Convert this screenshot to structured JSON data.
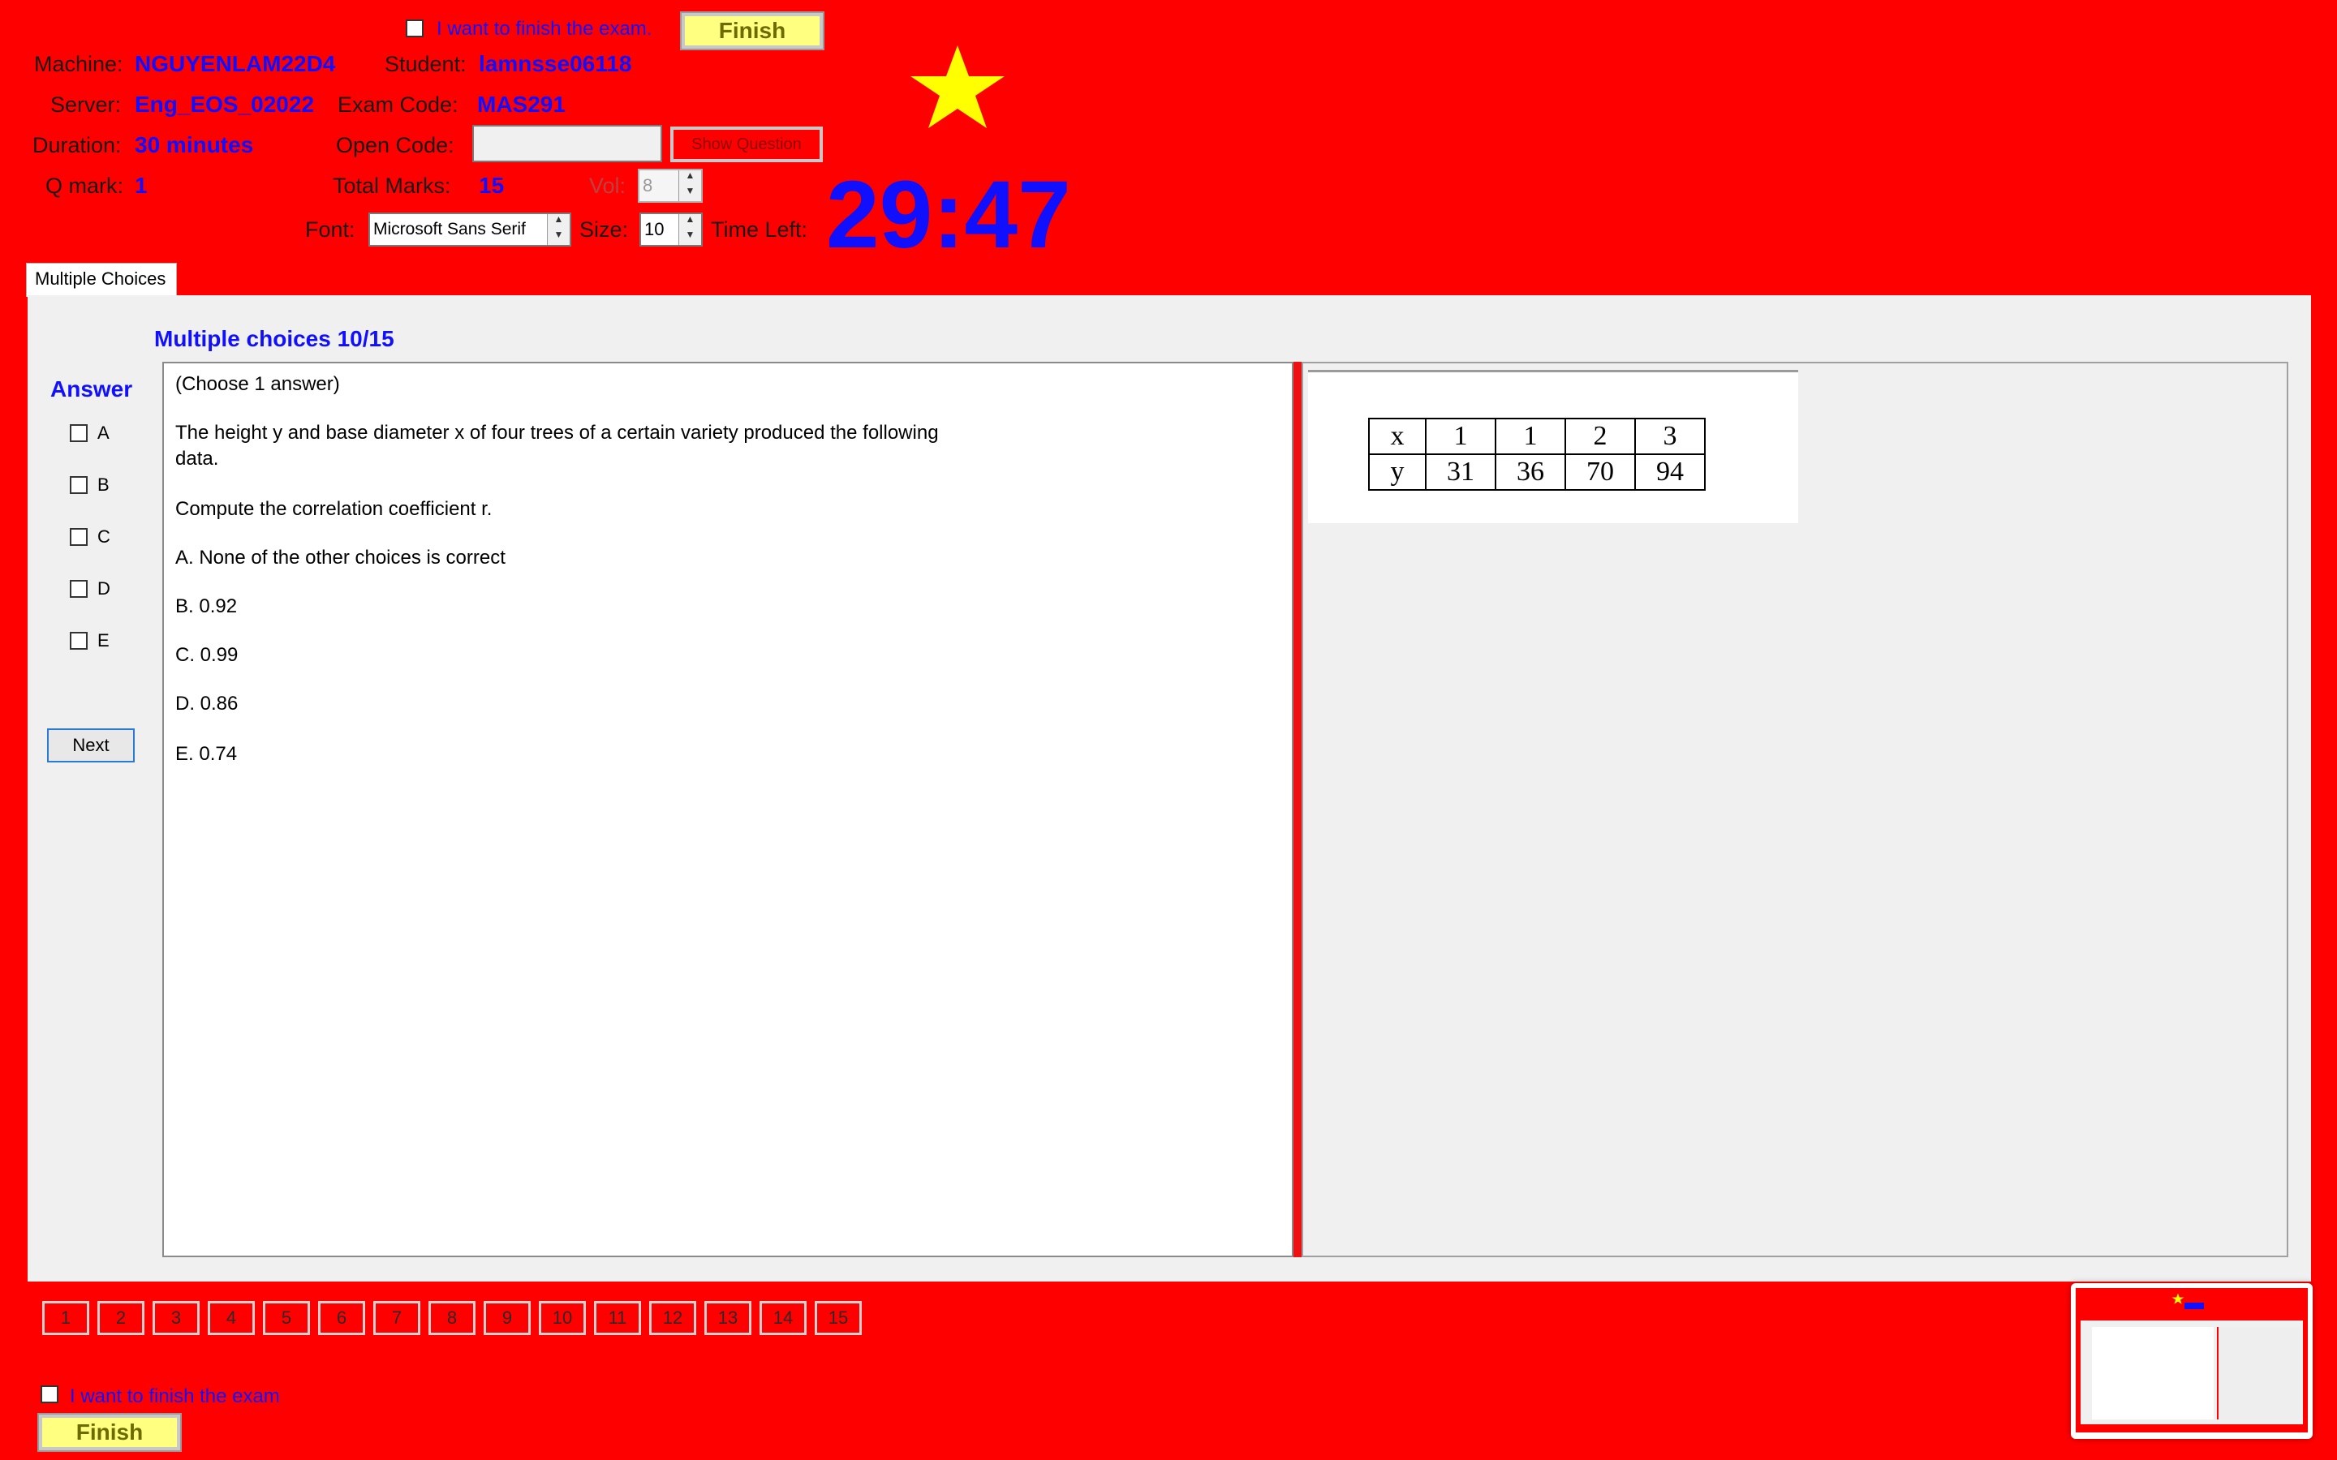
{
  "header": {
    "finish_top_label": "I want to finish the exam.",
    "finish_button": "Finish",
    "machine_label": "Machine:",
    "machine_value": "NGUYENLAM22D4",
    "student_label": "Student:",
    "student_value": "lamnsse06118",
    "server_label": "Server:",
    "server_value": "Eng_EOS_02022",
    "exam_code_label": "Exam Code:",
    "exam_code_value": "MAS291",
    "duration_label": "Duration:",
    "duration_value": "30 minutes",
    "open_code_label": "Open Code:",
    "open_code_value": "",
    "show_question_button": "Show Question",
    "qmark_label": "Q mark:",
    "qmark_value": "1",
    "total_marks_label": "Total Marks:",
    "total_marks_value": "15",
    "vol_label": "Vol:",
    "vol_value": "8",
    "font_label": "Font:",
    "font_value": "Microsoft Sans Serif",
    "size_label": "Size:",
    "size_value": "10",
    "time_left_label": "Time Left:",
    "time_left_value": "29:47"
  },
  "tabs": [
    "Multiple Choices"
  ],
  "question": {
    "heading": "Multiple choices 10/15",
    "answer_heading": "Answer",
    "answer_options": [
      "A",
      "B",
      "C",
      "D",
      "E"
    ],
    "next_button": "Next",
    "lines": [
      "(Choose 1 answer)",
      "The height y and base diameter x of four trees of a certain variety produced the following",
      "data.",
      "Compute the correlation coefficient  r.",
      "A.  None of the other choices is correct",
      "B.  0.92",
      "C.  0.99",
      "D.  0.86",
      "E.  0.74"
    ],
    "table": {
      "row_x": [
        "x",
        "1",
        "1",
        "2",
        "3"
      ],
      "row_y": [
        "y",
        "31",
        "36",
        "70",
        "94"
      ]
    }
  },
  "nav": {
    "questions": [
      "1",
      "2",
      "3",
      "4",
      "5",
      "6",
      "7",
      "8",
      "9",
      "10",
      "11",
      "12",
      "13",
      "14",
      "15"
    ]
  },
  "footer": {
    "finish_label": "I want to finish the exam",
    "finish_button": "Finish"
  },
  "colors": {
    "background": "#ff0000",
    "accent_text": "#1010ff",
    "star": "#ffff00",
    "finish_button": "#ffff80"
  }
}
